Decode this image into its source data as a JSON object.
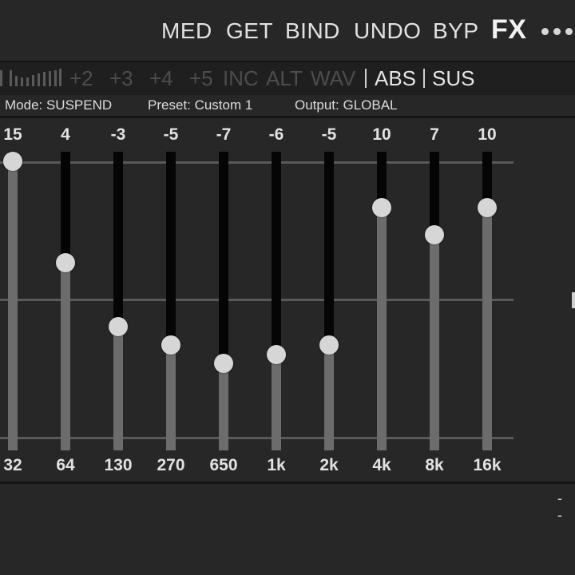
{
  "toolbar": {
    "buttons": [
      "MED",
      "GET",
      "BIND",
      "UNDO",
      "BYP"
    ],
    "fx_label": "FX",
    "more_icon": "more-horizontal-icon"
  },
  "row2": {
    "meter_icon": "level-meter-icon",
    "steps": [
      "+2",
      "+3",
      "+4",
      "+5"
    ],
    "modes": [
      "INC",
      "ALT",
      "WAV"
    ],
    "active": [
      "ABS",
      "SUS"
    ]
  },
  "status": {
    "mode": "Mode: SUSPEND",
    "preset": "Preset: Custom 1",
    "output": "Output:  GLOBAL"
  },
  "eq": {
    "range_db": [
      -15,
      15
    ],
    "bands": [
      {
        "freq": "32",
        "gain": 15
      },
      {
        "freq": "64",
        "gain": 4
      },
      {
        "freq": "130",
        "gain": -3
      },
      {
        "freq": "270",
        "gain": -5
      },
      {
        "freq": "650",
        "gain": -7
      },
      {
        "freq": "1k",
        "gain": -6
      },
      {
        "freq": "2k",
        "gain": -5
      },
      {
        "freq": "4k",
        "gain": 10
      },
      {
        "freq": "8k",
        "gain": 7
      },
      {
        "freq": "16k",
        "gain": 10
      }
    ]
  },
  "footer": {
    "dashes": "- -"
  },
  "colors": {
    "background": "#272727",
    "knob": "#d6d6d6",
    "track": "#050505",
    "fill": "#6c6c6c"
  }
}
